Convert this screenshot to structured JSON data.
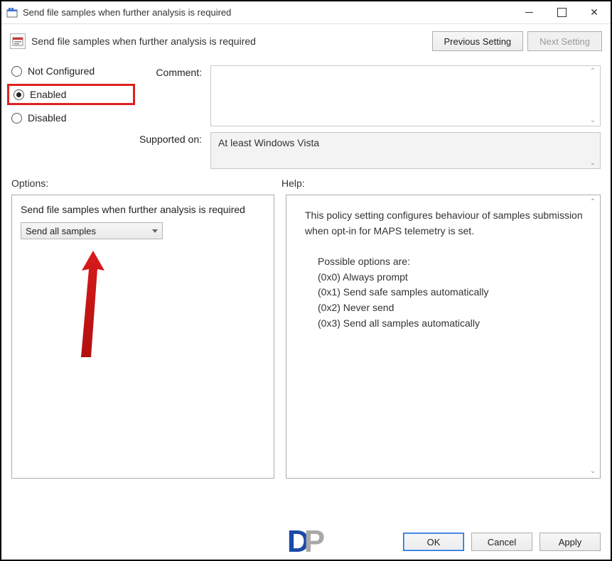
{
  "window": {
    "title": "Send file samples when further analysis is required"
  },
  "header": {
    "policy_title": "Send file samples when further analysis is required",
    "prev_btn": "Previous Setting",
    "next_btn": "Next Setting"
  },
  "radios": {
    "not_configured": "Not Configured",
    "enabled": "Enabled",
    "disabled": "Disabled",
    "selected": "enabled"
  },
  "labels": {
    "comment": "Comment:",
    "supported_on": "Supported on:",
    "options": "Options:",
    "help": "Help:"
  },
  "supported_on_value": "At least Windows Vista",
  "options_pane": {
    "field_label": "Send file samples when further analysis is required",
    "dropdown_value": "Send all samples"
  },
  "help_pane": {
    "intro": "This policy setting configures behaviour of samples submission when opt-in for MAPS telemetry is set.",
    "possible_label": "Possible options are:",
    "opts": {
      "o0": "(0x0) Always prompt",
      "o1": "(0x1) Send safe samples automatically",
      "o2": "(0x2) Never send",
      "o3": "(0x3) Send all samples automatically"
    }
  },
  "buttons": {
    "ok": "OK",
    "cancel": "Cancel",
    "apply": "Apply"
  }
}
